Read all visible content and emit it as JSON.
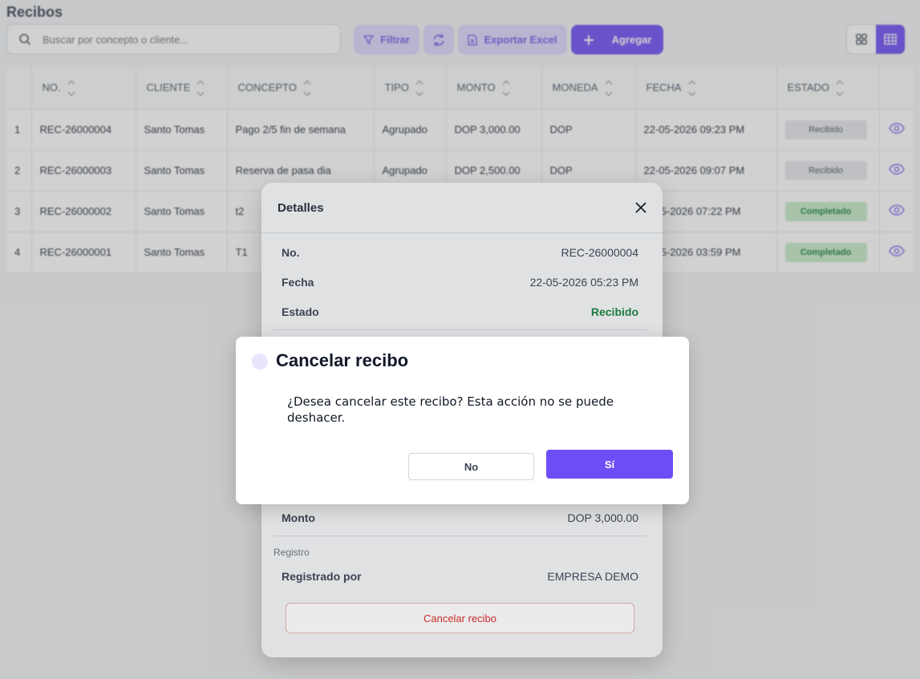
{
  "page_title": "Recibos",
  "search": {
    "placeholder": "Buscar por concepto o cliente..."
  },
  "toolbar": {
    "filter": "Filtrar",
    "export": "Exportar Excel",
    "add": "Agregar"
  },
  "table": {
    "headers": [
      "NO.",
      "CLIENTE",
      "CONCEPTO",
      "TIPO",
      "MONTO",
      "MONEDA",
      "FECHA",
      "ESTADO"
    ],
    "rows": [
      {
        "idx": "1",
        "no": "REC-26000004",
        "cliente": "Santo Tomas",
        "concepto": "Pago 2/5 fin de semana",
        "tipo": "Agrupado",
        "monto": "DOP 3,000.00",
        "moneda": "DOP",
        "fecha": "22-05-2026 09:23 PM",
        "estado": "Recibido"
      },
      {
        "idx": "2",
        "no": "REC-26000003",
        "cliente": "Santo Tomas",
        "concepto": "Reserva de pasa dia",
        "tipo": "Agrupado",
        "monto": "DOP 2,500.00",
        "moneda": "DOP",
        "fecha": "22-05-2026 09:07 PM",
        "estado": "Recibido"
      },
      {
        "idx": "3",
        "no": "REC-26000002",
        "cliente": "Santo Tomas",
        "concepto": "t2",
        "tipo": "",
        "monto": "",
        "moneda": "",
        "fecha": "05-2026 07:22 PM",
        "estado": "Completado"
      },
      {
        "idx": "4",
        "no": "REC-26000001",
        "cliente": "Santo Tomas",
        "concepto": "T1",
        "tipo": "",
        "monto": "",
        "moneda": "",
        "fecha": "05-2026 03:59 PM",
        "estado": "Completado"
      }
    ]
  },
  "detail": {
    "title": "Detalles",
    "no_label": "No.",
    "no_value": "REC-26000004",
    "fecha_label": "Fecha",
    "fecha_value": "22-05-2026 05:23 PM",
    "estado_label": "Estado",
    "estado_value": "Recibido",
    "monto_label": "Monto",
    "monto_value": "DOP 3,000.00",
    "section_registro": "Registro",
    "registrado_label": "Registrado por",
    "registrado_value": "EMPRESA DEMO",
    "cancel_button": "Cancelar recibo"
  },
  "confirm": {
    "title": "Cancelar recibo",
    "message": "¿Desea cancelar este recibo? Esta acción no se puede deshacer.",
    "no": "No",
    "yes": "Sí"
  },
  "colors": {
    "accent": "#6d4df5",
    "accent_light": "#ddd6fe",
    "success": "#15803d",
    "danger": "#dc2626"
  }
}
